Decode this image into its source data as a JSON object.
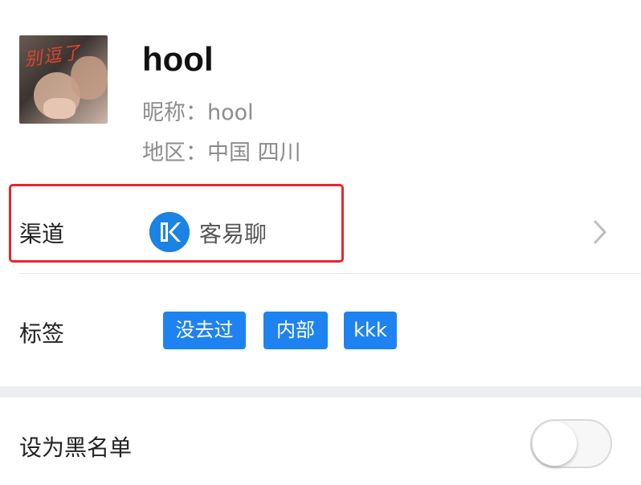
{
  "profile": {
    "display_name": "hool",
    "avatar_caption": "别逗了",
    "nickname_line": "昵称：hool",
    "region_line": "地区：中国 四川"
  },
  "channel": {
    "label": "渠道",
    "icon": "kyl-logo-icon",
    "name": "客易聊",
    "chevron_icon": "chevron-right-icon"
  },
  "tags": {
    "label": "标签",
    "items": [
      "没去过",
      "内部",
      "kkk"
    ]
  },
  "blacklist": {
    "label": "设为黑名单",
    "enabled": false
  },
  "colors": {
    "accent": "#1e83f0",
    "highlight": "#e5262d",
    "muted_text": "#8c8c8c"
  }
}
